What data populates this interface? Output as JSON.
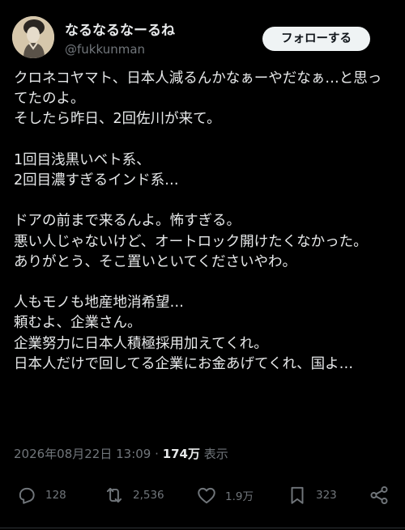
{
  "user": {
    "display_name": "なるなるなーるね",
    "handle": "@fukkunman"
  },
  "follow_button_label": "フォローする",
  "tweet": {
    "text": "クロネコヤマト、日本人減るんかなぁーやだなぁ…と思ってたのよ。\nそしたら昨日、2回佐川が来て。\n\n1回目浅黒いベト系、\n2回目濃すぎるインド系…\n\nドアの前まで来るんよ。怖すぎる。\n悪い人じゃないけど、オートロック開けたくなかった。\nありがとう、そこ置いといてくださいやわ。\n\n人もモノも地産地消希望…\n頼むよ、企業さん。\n企業努力に日本人積極採用加えてくれ。\n日本人だけで回してる企業にお金あげてくれ、国よ…"
  },
  "meta": {
    "timestamp": "2026年08月22日 13:09",
    "separator": "·",
    "views_count": "174万",
    "views_label": "表示"
  },
  "actions": {
    "replies": "128",
    "reposts": "2,536",
    "likes": "1.9万",
    "bookmarks": "323"
  },
  "colors": {
    "background": "#000000",
    "text": "#e7e9ea",
    "secondary_text": "#71767b",
    "follow_button_bg": "#eff3f4"
  }
}
